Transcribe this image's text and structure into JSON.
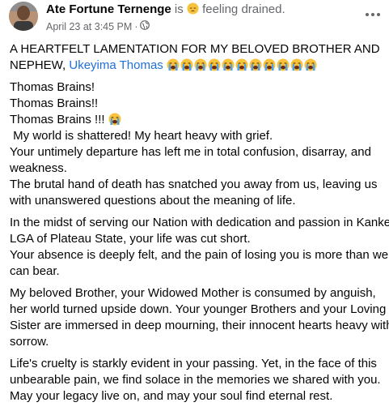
{
  "post": {
    "author": "Ate Fortune Ternenge",
    "status_prefix": " is ",
    "feeling": " feeling drained.",
    "feeling_icon": "pensive-face-icon",
    "timestamp": "April 23 at 3:45 PM",
    "separator": " · ",
    "audience_icon": "globe-icon",
    "title_text": "A HEARTFELT LAMENTATION FOR MY BELOVED BROTHER AND NEPHEW, ",
    "tagged_name": "Ukeyima Thomas",
    "title_emoji": "loudly-crying-face-icon",
    "title_emoji_count": 11,
    "paragraphs": [
      [
        "Thomas Brains!",
        "Thomas Brains!!",
        "Thomas Brains !!! ",
        " My world is shattered! My heart heavy with grief.",
        "Your untimely departure has left me in total confusion, disarray, and",
        "weakness.",
        "The brutal hand of death has snatched you away from us, leaving us",
        "with unanswered questions about the meaning of life."
      ],
      [
        "In the midst of serving our Nation with dedication and passion in Kanke",
        "LGA of Plateau State, your life was cut short.",
        "Your absence is deeply felt, and the pain of losing you is more than we",
        "can bear."
      ],
      [
        "My beloved Brother, your Widowed Mother is consumed by anguish,",
        "her world turned upside down. Your younger Brothers and your Loving",
        "Sister are immersed in deep mourning, their innocent hearts heavy with",
        "sorrow."
      ],
      [
        "Life's cruelty is starkly evident in your passing. Yet, in the face of this",
        "unbearable pain, we find solace in the memories we shared with you.",
        "May your legacy live on, and may your soul find eternal rest."
      ]
    ]
  }
}
